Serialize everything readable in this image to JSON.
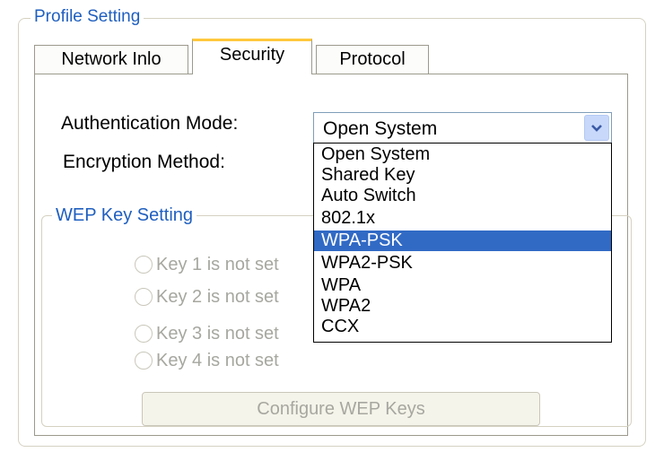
{
  "profile_setting": {
    "title": "Profile Setting",
    "tabs": [
      {
        "label": "Network Inlo"
      },
      {
        "label": "Security"
      },
      {
        "label": "Protocol"
      }
    ],
    "active_tab": "Security"
  },
  "security": {
    "authentication_mode_label": "Authentication Mode:",
    "authentication_mode_value": "Open System",
    "encryption_method_label": "Encryption Method:",
    "auth_options": [
      "Open System",
      "Shared Key",
      "Auto Switch",
      "802.1x",
      "WPA-PSK",
      "WPA2-PSK",
      "WPA",
      "WPA2",
      "CCX"
    ],
    "highlighted_option": "WPA-PSK"
  },
  "wep": {
    "title": "WEP Key Setting",
    "keys": [
      {
        "label": "Key 1 is not set"
      },
      {
        "label": "Key 2 is not set"
      },
      {
        "label": "Key 3 is not set"
      },
      {
        "label": "Key 4 is not set"
      }
    ],
    "configure_button_label": "Configure WEP Keys"
  },
  "colors": {
    "accent_title": "#1f5fbf",
    "selection": "#316ac5",
    "tab_highlight": "#ffc83d"
  }
}
